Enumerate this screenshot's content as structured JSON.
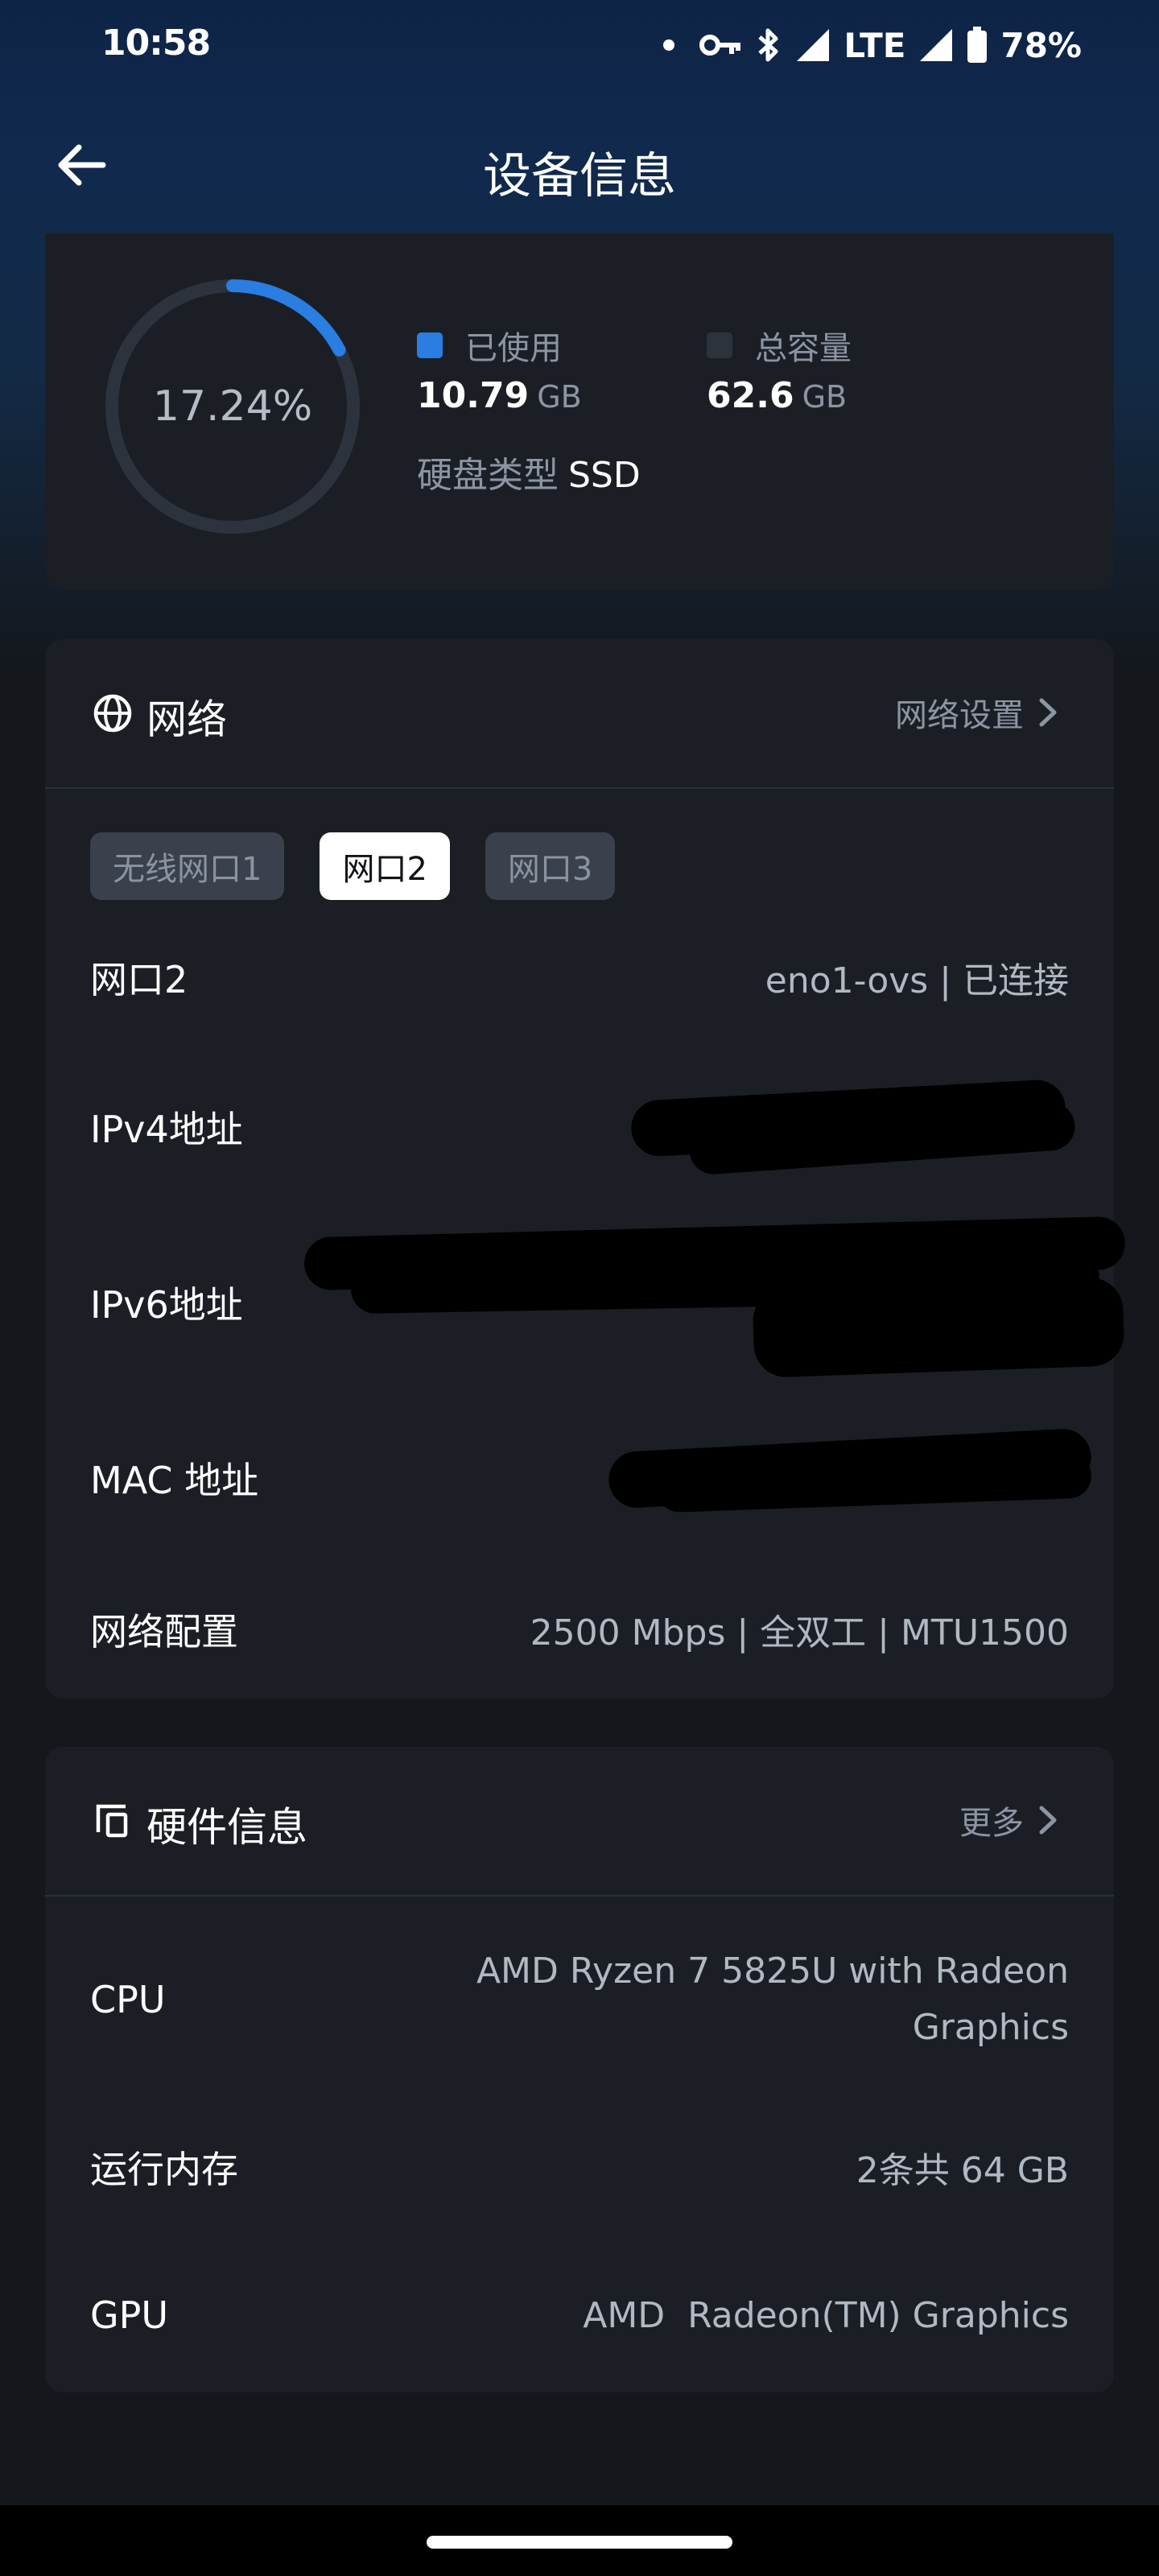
{
  "status_bar": {
    "time": "10:58",
    "network": "LTE",
    "battery": "78%"
  },
  "app_bar": {
    "title": "设备信息"
  },
  "storage": {
    "percent_label": "17.24%",
    "used_fraction": 0.1724,
    "used_label": "已使用",
    "used_value": "10.79",
    "used_unit": "GB",
    "total_label": "总容量",
    "total_value": "62.6",
    "total_unit": "GB",
    "disk_type_label": "硬盘类型",
    "disk_type_value": "SSD",
    "colors": {
      "used": "#2a7de1",
      "remaining": "#2c333d"
    }
  },
  "network": {
    "title": "网络",
    "settings_link": "网络设置",
    "tabs": [
      {
        "label": "无线网口1",
        "active": false
      },
      {
        "label": "网口2",
        "active": true
      },
      {
        "label": "网口3",
        "active": false
      }
    ],
    "rows": {
      "port_label": "网口2",
      "port_value": "eno1-ovs | 已连接",
      "ipv4_label": "IPv4地址",
      "ipv6_label": "IPv6地址",
      "mac_label": "MAC 地址",
      "config_label": "网络配置",
      "config_value": "2500 Mbps | 全双工 | MTU1500"
    }
  },
  "hardware": {
    "title": "硬件信息",
    "more_link": "更多",
    "rows": {
      "cpu_label": "CPU",
      "cpu_value_line1": "AMD Ryzen 7 5825U with Radeon",
      "cpu_value_line2": "Graphics",
      "memory_label": "运行内存",
      "memory_value": "2条共 64 GB",
      "gpu_label": "GPU",
      "gpu_value": "AMD  Radeon(TM) Graphics"
    }
  }
}
